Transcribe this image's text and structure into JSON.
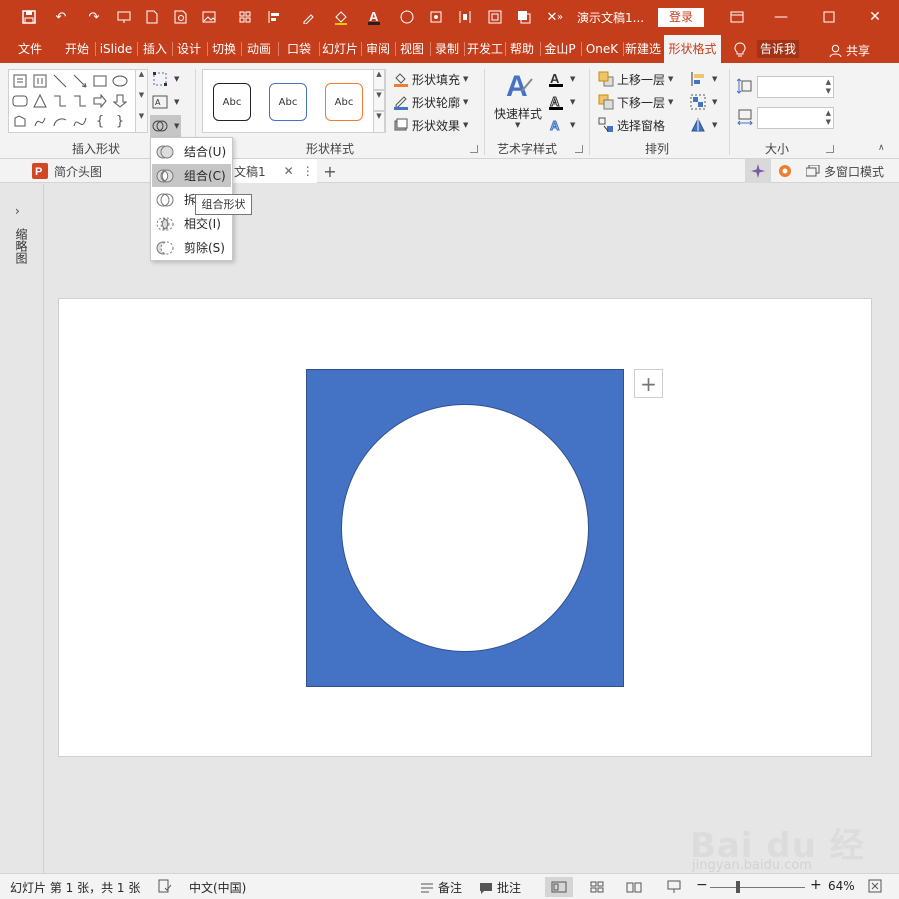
{
  "titlebar": {
    "doc_title": "演示文稿1...",
    "login": "登录"
  },
  "tabs": [
    {
      "label": "文件"
    },
    {
      "label": "开始"
    },
    {
      "label": "iSlide"
    },
    {
      "label": "插入"
    },
    {
      "label": "设计"
    },
    {
      "label": "切换"
    },
    {
      "label": "动画"
    },
    {
      "label": "口袋"
    },
    {
      "label": "幻灯片"
    },
    {
      "label": "审阅"
    },
    {
      "label": "视图"
    },
    {
      "label": "录制"
    },
    {
      "label": "开发工"
    },
    {
      "label": "帮助"
    },
    {
      "label": "金山P"
    },
    {
      "label": "OneK"
    },
    {
      "label": "新建选"
    },
    {
      "label": "形状格式"
    }
  ],
  "tell_me": "告诉我",
  "share": "共享",
  "ribbon": {
    "groups": {
      "insert_shapes": "插入形状",
      "shape_styles": "形状样式",
      "wordart": "艺术字样式",
      "arrange": "排列",
      "size": "大小"
    },
    "style_samples": [
      "Abc",
      "Abc",
      "Abc"
    ],
    "shape_fill": "形状填充",
    "shape_outline": "形状轮廓",
    "shape_effects": "形状效果",
    "quick_styles": "快速样式",
    "bring_forward": "上移一层",
    "send_backward": "下移一层",
    "selection_pane": "选择窗格"
  },
  "merge_menu": {
    "items": [
      {
        "label": "结合(U)"
      },
      {
        "label": "组合(C)"
      },
      {
        "label": "拆"
      },
      {
        "label": "相交(I)"
      },
      {
        "label": "剪除(S)"
      }
    ],
    "tooltip": "组合形状"
  },
  "doctabs": {
    "first": "简介头图",
    "second": "文稿1",
    "multi_window": "多窗口模式"
  },
  "leftpanel": {
    "label": "缩略图"
  },
  "statusbar": {
    "slide_info": "幻灯片 第 1 张，共 1 张",
    "language": "中文(中国)",
    "notes": "备注",
    "comments": "批注",
    "zoom": "64%"
  },
  "colors": {
    "accent": "#c43e1c",
    "shape_fill": "#4472c4",
    "shape_line": "#2f528f"
  },
  "watermark": {
    "brand": "Bai du 经验",
    "url": "jingyan.baidu.com"
  }
}
